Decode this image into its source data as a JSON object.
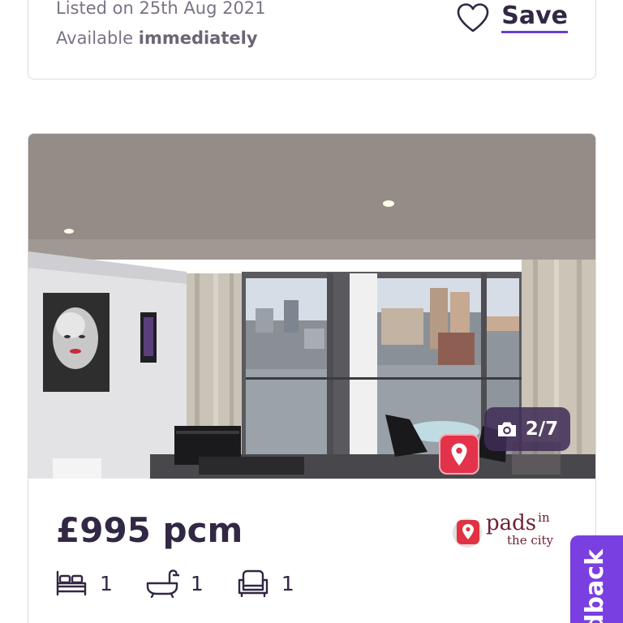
{
  "top_card": {
    "listed": "Listed on 25th Aug 2021",
    "available_prefix": "Available",
    "available_value": "immediately",
    "save_label": "Save"
  },
  "listing": {
    "photo_counter": "2/7",
    "price": "£995 pcm",
    "agent_logo": {
      "name": "pads",
      "superscript": "in",
      "subtitle": "the city"
    },
    "features": [
      {
        "icon": "bed-icon",
        "count": "1"
      },
      {
        "icon": "bath-icon",
        "count": "1"
      },
      {
        "icon": "armchair-icon",
        "count": "1"
      }
    ]
  },
  "feedback_tab": {
    "label": "Feedback",
    "visible_text": "dback"
  },
  "colors": {
    "text_dark": "#322744",
    "text_muted": "#7b7286",
    "accent_purple": "#6b3fd3",
    "feedback_purple": "#7a3fe0",
    "counter_bg": "#402c56",
    "pin_red": "#e2334a"
  }
}
